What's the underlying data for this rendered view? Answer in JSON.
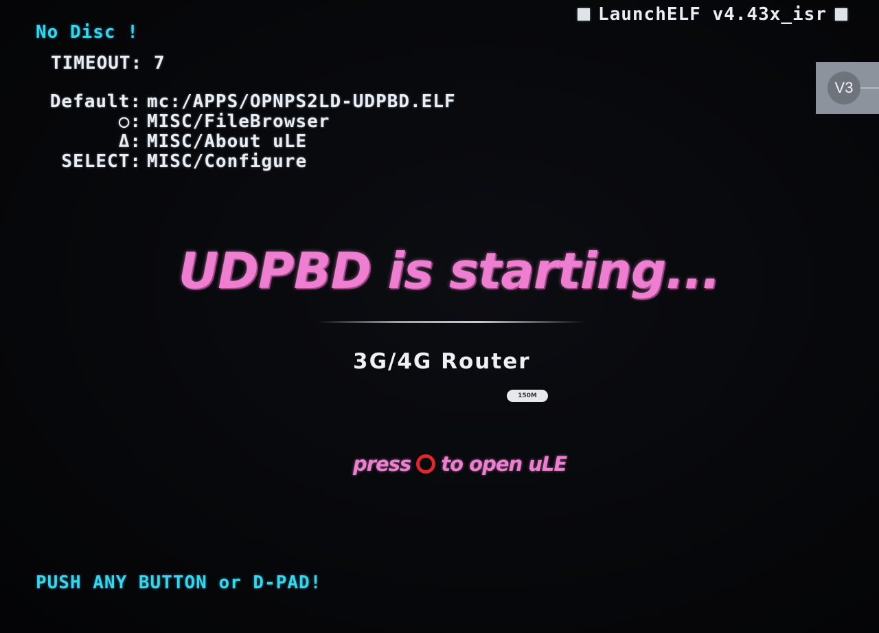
{
  "header": {
    "title": "LaunchELF v4.43x_isr",
    "left_icon": "square-icon",
    "right_icon": "square-icon"
  },
  "status": {
    "disc": "No Disc !",
    "timeout_label": "TIMEOUT:",
    "timeout_value": "7"
  },
  "launch_list": [
    {
      "key": "Default:",
      "value": "mc:/APPS/OPNPS2LD-UDPBD.ELF"
    },
    {
      "key": "○:",
      "value": "MISC/FileBrowser"
    },
    {
      "key": "Δ:",
      "value": "MISC/About uLE"
    },
    {
      "key": "SELECT:",
      "value": "MISC/Configure"
    }
  ],
  "overlay_badge": {
    "label": "V3"
  },
  "splash": {
    "title": "UDPBD is starting...",
    "router_label": "3G/4G Router",
    "speed_badge": "150M",
    "press_before": "press",
    "press_icon": "circle-button-icon",
    "press_after": "to open uLE"
  },
  "footer": {
    "hint": "PUSH ANY BUTTON or D-PAD!"
  },
  "colors": {
    "cyan_text": "#34d6f0",
    "white_text": "#e9eef5",
    "pink_text": "#ee7fd0",
    "circle_button": "#e3262b",
    "background": "#050508"
  }
}
